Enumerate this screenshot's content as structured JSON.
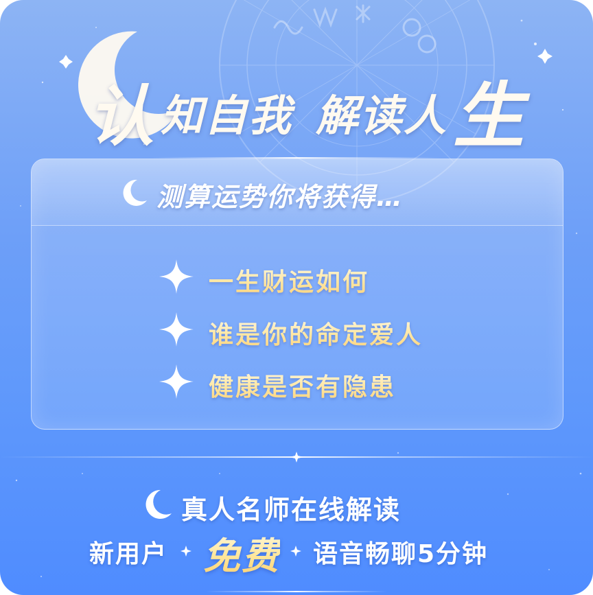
{
  "title": {
    "part1": "认",
    "part2": "知自我",
    "part3": "解读人",
    "part4": "生"
  },
  "panel": {
    "heading": "测算运势你将获得…",
    "features": [
      "一生财运如何",
      "谁是你的命定爱人",
      "健康是否有隐患"
    ]
  },
  "bottom": {
    "headline": "真人名师在线解读",
    "new_user": "新用户",
    "free": "免费",
    "voice_chat": "语音畅聊5分钟"
  },
  "colors": {
    "background_top": "#8db4f4",
    "background_bottom": "#4f8cff",
    "gold_text": "#ffe7a3",
    "white_text": "#ffffff"
  },
  "icons": [
    "crescent-moon-icon",
    "four-point-star-icon",
    "zodiac-wheel-icon"
  ]
}
